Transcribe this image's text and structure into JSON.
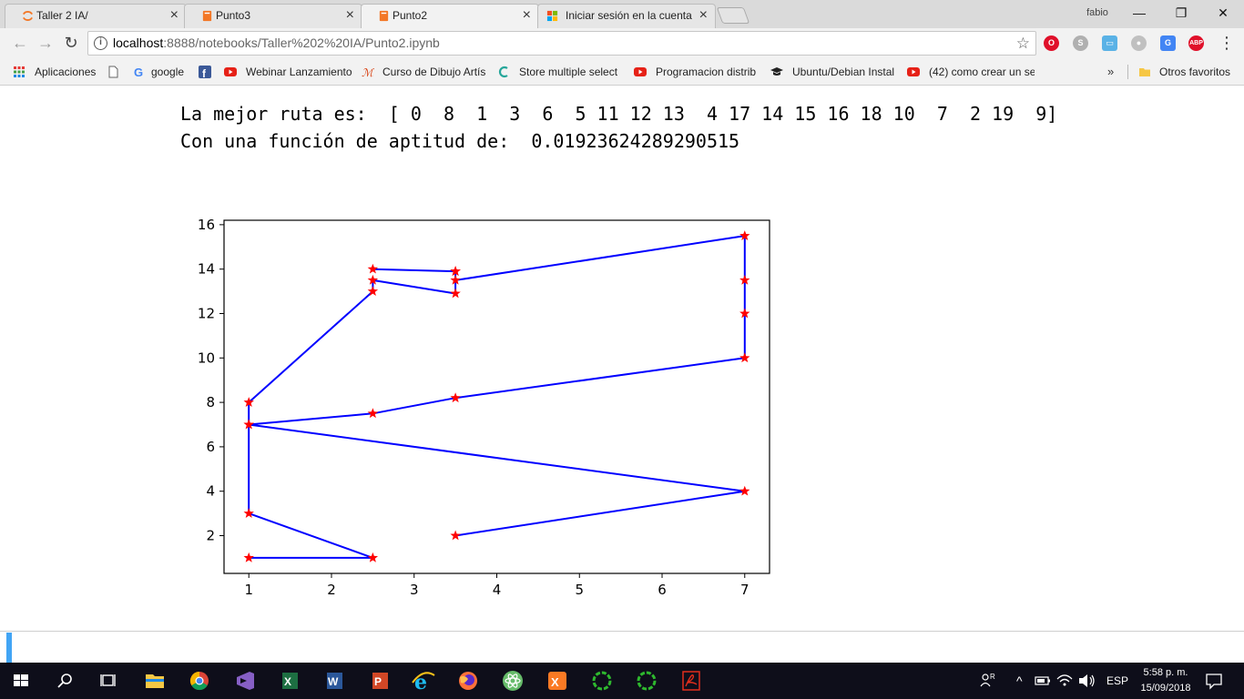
{
  "tabs": [
    {
      "label": "Taller 2 IA/",
      "icon": "jupyter-icon",
      "active": false
    },
    {
      "label": "Punto3",
      "icon": "notebook-icon",
      "active": false
    },
    {
      "label": "Punto2",
      "icon": "notebook-icon",
      "active": true
    },
    {
      "label": "Iniciar sesión en la cuenta",
      "icon": "microsoft-icon",
      "active": false
    }
  ],
  "profile_name": "fabio",
  "window_controls": {
    "minimize": "—",
    "restore": "❐",
    "close": "✕"
  },
  "address_bar": {
    "host": "localhost",
    "path": ":8888/notebooks/Taller%202%20IA/Punto2.ipynb"
  },
  "bookmarks": [
    {
      "label": "Aplicaciones",
      "icon": "apps-grid-icon"
    },
    {
      "label": "",
      "icon": "page-icon"
    },
    {
      "label": "google",
      "icon": "google-icon"
    },
    {
      "label": "",
      "icon": "facebook-icon"
    },
    {
      "label": "Webinar Lanzamiento",
      "icon": "youtube-icon"
    },
    {
      "label": "Curso de Dibujo Artís",
      "icon": "art-icon"
    },
    {
      "label": "Store multiple select",
      "icon": "c-icon"
    },
    {
      "label": "Programacion distrib",
      "icon": "youtube-icon"
    },
    {
      "label": "Ubuntu/Debian Instal",
      "icon": "graduation-cap-icon"
    },
    {
      "label": "(42) como crear un se",
      "icon": "youtube-icon"
    }
  ],
  "bookmarks_more": "»",
  "other_bookmarks": "Otros favoritos",
  "notebook": {
    "output_line1": "La mejor ruta es:  [ 0  8  1  3  6  5 11 12 13  4 17 14 15 16 18 10  7  2 19  9]",
    "output_line2": "Con una función de aptitud de:  0.01923624289290515"
  },
  "chart_data": {
    "type": "line",
    "title": "",
    "xlabel": "",
    "ylabel": "",
    "xlim": [
      0.7,
      7.3
    ],
    "ylim": [
      0.3,
      16.2
    ],
    "xticks": [
      1,
      2,
      3,
      4,
      5,
      6,
      7
    ],
    "yticks": [
      2,
      4,
      6,
      8,
      10,
      12,
      14,
      16
    ],
    "grid": false,
    "line_color": "#0000ff",
    "marker": "star",
    "marker_color": "#ff0000",
    "series": [
      {
        "x": [
          3.5,
          7,
          1,
          2.5,
          3.5,
          7,
          7,
          7,
          7,
          3.5,
          3.5,
          2.5,
          3.5,
          3.5,
          2.5,
          2.5,
          1,
          1,
          1,
          2.5,
          1
        ],
        "y": [
          2,
          4,
          7,
          7.5,
          8.2,
          10,
          12,
          13.5,
          15.5,
          13.5,
          13.9,
          14,
          13.9,
          12.9,
          13.5,
          13,
          8,
          7,
          3,
          1,
          1
        ]
      }
    ]
  },
  "taskbar": {
    "apps": [
      {
        "name": "windows-start-icon"
      },
      {
        "name": "search-icon"
      },
      {
        "name": "task-view-icon"
      },
      {
        "name": "file-explorer-icon"
      },
      {
        "name": "chrome-icon"
      },
      {
        "name": "visual-studio-icon"
      },
      {
        "name": "excel-icon"
      },
      {
        "name": "word-icon"
      },
      {
        "name": "powerpoint-icon"
      },
      {
        "name": "internet-explorer-icon"
      },
      {
        "name": "firefox-icon"
      },
      {
        "name": "atom-icon"
      },
      {
        "name": "xampp-icon"
      },
      {
        "name": "spinner-icon"
      },
      {
        "name": "spinner-icon"
      },
      {
        "name": "acrobat-icon"
      }
    ],
    "language": "ESP",
    "time": "5:58 p. m.",
    "date": "15/09/2018"
  }
}
